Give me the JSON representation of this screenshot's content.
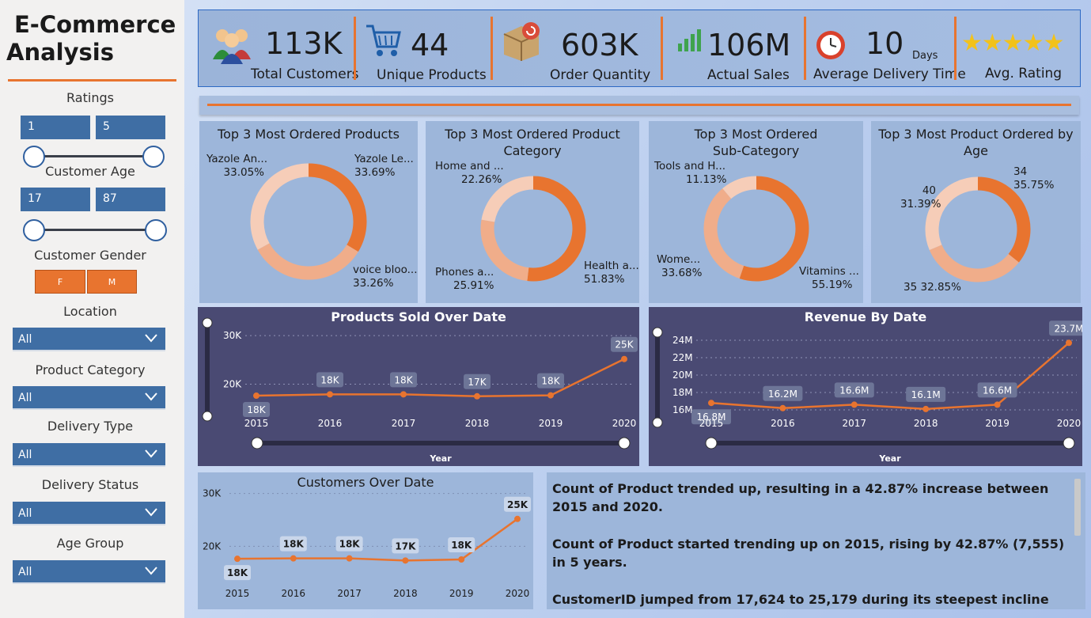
{
  "sidebar": {
    "title_line1": "E-Commerce",
    "title_line2": "Analysis",
    "ratings": {
      "label": "Ratings",
      "min": "1",
      "max": "5"
    },
    "age": {
      "label": "Customer Age",
      "min": "17",
      "max": "87"
    },
    "gender": {
      "label": "Customer Gender",
      "options": [
        "F",
        "M"
      ]
    },
    "location": {
      "label": "Location",
      "value": "All"
    },
    "product_category": {
      "label": "Product Category",
      "value": "All"
    },
    "delivery_type": {
      "label": "Delivery Type",
      "value": "All"
    },
    "delivery_status": {
      "label": "Delivery Status",
      "value": "All"
    },
    "age_group": {
      "label": "Age Group",
      "value": "All"
    }
  },
  "kpis": [
    {
      "value": "113K",
      "label": "Total Customers",
      "icon": "customers-icon"
    },
    {
      "value": "44",
      "label": "Unique Products",
      "icon": "cart-icon"
    },
    {
      "value": "603K",
      "label": "Order Quantity",
      "icon": "box-icon"
    },
    {
      "value": "106M",
      "label": "Actual Sales",
      "icon": "bar-chart-icon"
    },
    {
      "value": "10",
      "unit": "Days",
      "label": "Average Delivery Time",
      "icon": "clock-icon"
    },
    {
      "value": "★★★★★",
      "label": "Avg. Rating",
      "icon": "stars-icon"
    }
  ],
  "donuts": [
    {
      "title": "Top 3 Most Ordered Products",
      "slices": [
        {
          "name": "Yazole Le...",
          "pct": "33.69%",
          "value": 33.69,
          "color": "#e8742f"
        },
        {
          "name": "voice bloo...",
          "pct": "33.26%",
          "value": 33.26,
          "color": "#f0ad8a"
        },
        {
          "name": "Yazole An...",
          "pct": "33.05%",
          "value": 33.05,
          "color": "#f6cdb8"
        }
      ]
    },
    {
      "title_line1": "Top 3 Most Ordered Product",
      "title_line2": "Category",
      "slices": [
        {
          "name": "Health a...",
          "pct": "51.83%",
          "value": 51.83,
          "color": "#e8742f"
        },
        {
          "name": "Phones a...",
          "pct": "25.91%",
          "value": 25.91,
          "color": "#f0ad8a"
        },
        {
          "name": "Home and ...",
          "pct": "22.26%",
          "value": 22.26,
          "color": "#f6cdb8"
        }
      ]
    },
    {
      "title_line1": "Top 3 Most Ordered",
      "title_line2": "Sub-Category",
      "slices": [
        {
          "name": "Vitamins ...",
          "pct": "55.19%",
          "value": 55.19,
          "color": "#e8742f"
        },
        {
          "name": "Wome...",
          "pct": "33.68%",
          "value": 33.68,
          "color": "#f0ad8a"
        },
        {
          "name": "Tools and H...",
          "pct": "11.13%",
          "value": 11.13,
          "color": "#f6cdb8"
        }
      ]
    },
    {
      "title_line1": "Top 3 Most Product Ordered by",
      "title_line2": "Age",
      "slices": [
        {
          "name": "34",
          "pct": "35.75%",
          "value": 35.75,
          "color": "#e8742f"
        },
        {
          "name": "35",
          "pct": "32.85%",
          "value": 32.85,
          "color": "#f0ad8a"
        },
        {
          "name": "40",
          "pct": "31.39%",
          "value": 31.39,
          "color": "#f6cdb8"
        }
      ]
    }
  ],
  "chart_data": [
    {
      "type": "line",
      "title": "Products Sold Over Date",
      "xlabel": "Year",
      "x": [
        "2015",
        "2016",
        "2017",
        "2018",
        "2019",
        "2020"
      ],
      "values": [
        17624,
        17900,
        17900,
        17500,
        17700,
        25179
      ],
      "data_labels": [
        "18K",
        "18K",
        "18K",
        "17K",
        "18K",
        "25K"
      ],
      "yticks": [
        "20K",
        "30K"
      ],
      "ylim": [
        16000,
        31000
      ]
    },
    {
      "type": "line",
      "title": "Revenue By Date",
      "xlabel": "Year",
      "x": [
        "2015",
        "2016",
        "2017",
        "2018",
        "2019",
        "2020"
      ],
      "values": [
        16.8,
        16.2,
        16.6,
        16.1,
        16.6,
        23.7
      ],
      "data_labels": [
        "16.8M",
        "16.2M",
        "16.6M",
        "16.1M",
        "16.6M",
        "23.7M"
      ],
      "yticks": [
        "16M",
        "18M",
        "20M",
        "22M",
        "24M"
      ],
      "ylim": [
        16,
        24
      ]
    },
    {
      "type": "line",
      "title": "Customers Over Date",
      "x": [
        "2015",
        "2016",
        "2017",
        "2018",
        "2019",
        "2020"
      ],
      "values": [
        17624,
        17700,
        17700,
        17300,
        17500,
        25179
      ],
      "data_labels": [
        "18K",
        "18K",
        "18K",
        "17K",
        "18K",
        "25K"
      ],
      "yticks": [
        "20K",
        "30K"
      ],
      "ylim": [
        13000,
        31000
      ]
    }
  ],
  "narrative": [
    "Count of Product trended up, resulting in a 42.87% increase between 2015 and 2020.",
    "Count of Product started trending up on 2015, rising by 42.87% (7,555) in 5 years.",
    "CustomerID jumped from 17,624 to 25,179 during its steepest incline between"
  ],
  "colors": {
    "accent": "#e8742f",
    "dark_panel": "#4a4a73",
    "card": "#9db6da",
    "control": "#3f6ea4"
  }
}
